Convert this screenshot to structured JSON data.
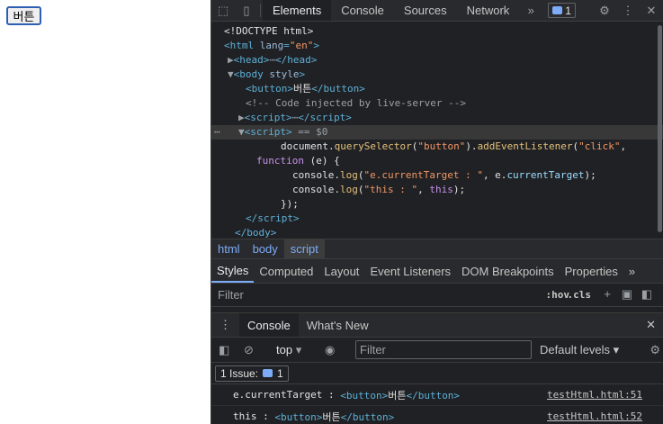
{
  "page": {
    "button_label": "버튼"
  },
  "devtools": {
    "tabs": [
      "Elements",
      "Console",
      "Sources",
      "Network"
    ],
    "issue_count": "1",
    "code_lines": {
      "doctype": "<!DOCTYPE html>",
      "html_tag": "html",
      "html_attr": "lang",
      "html_attr_val": "\"en\"",
      "head": "head",
      "body_tag": "body",
      "body_attr": "style",
      "button_tag": "button",
      "button_text": "버튼",
      "comment": "<!-- Code injected by live-server -->",
      "script_tag": "script",
      "sel_marker": "== $0",
      "l1_a": "document.",
      "l1_fn": "querySelector",
      "l1_str": "\"button\"",
      "l1_fn2": "addEventListener",
      "l1_str2": "\"click\"",
      "l2_kw": "function",
      "l2_rest": " (e) {",
      "l3_a": "console.",
      "l3_fn": "log",
      "l3_str": "\"e.currentTarget : \"",
      "l3_rest": ", e.",
      "l3_prop": "currentTarget",
      "l4_str": "\"this : \"",
      "l4_kw": "this",
      "l5": "});"
    },
    "breadcrumbs": [
      "html",
      "body",
      "script"
    ],
    "style_tabs": [
      "Styles",
      "Computed",
      "Layout",
      "Event Listeners",
      "DOM Breakpoints",
      "Properties"
    ],
    "styles_filter_placeholder": "Filter",
    "hov": ":hov",
    "cls": ".cls"
  },
  "drawer": {
    "tabs": [
      "Console",
      "What's New"
    ],
    "context": "top",
    "filter_placeholder": "Filter",
    "levels": "Default levels",
    "issues_label": "1 Issue:",
    "issues_count": "1",
    "logs": [
      {
        "label": "e.currentTarget : ",
        "value_text": "버튼",
        "source": "testHtml.html:51"
      },
      {
        "label": "this : ",
        "value_text": "버튼",
        "source": "testHtml.html:52"
      }
    ]
  },
  "colors": {
    "panel_bg": "#202124",
    "toolbar_bg": "#292a2d",
    "accent": "#7cacf8",
    "tag": "#5db0d7",
    "string": "#f29766"
  },
  "icons": [
    "inspect-icon",
    "device-icon",
    "more-tabs-icon",
    "settings-icon",
    "kebab-icon",
    "close-icon",
    "new-style-rule-icon",
    "sidebar-toggle-icon",
    "clear-console-icon",
    "eye-icon"
  ]
}
